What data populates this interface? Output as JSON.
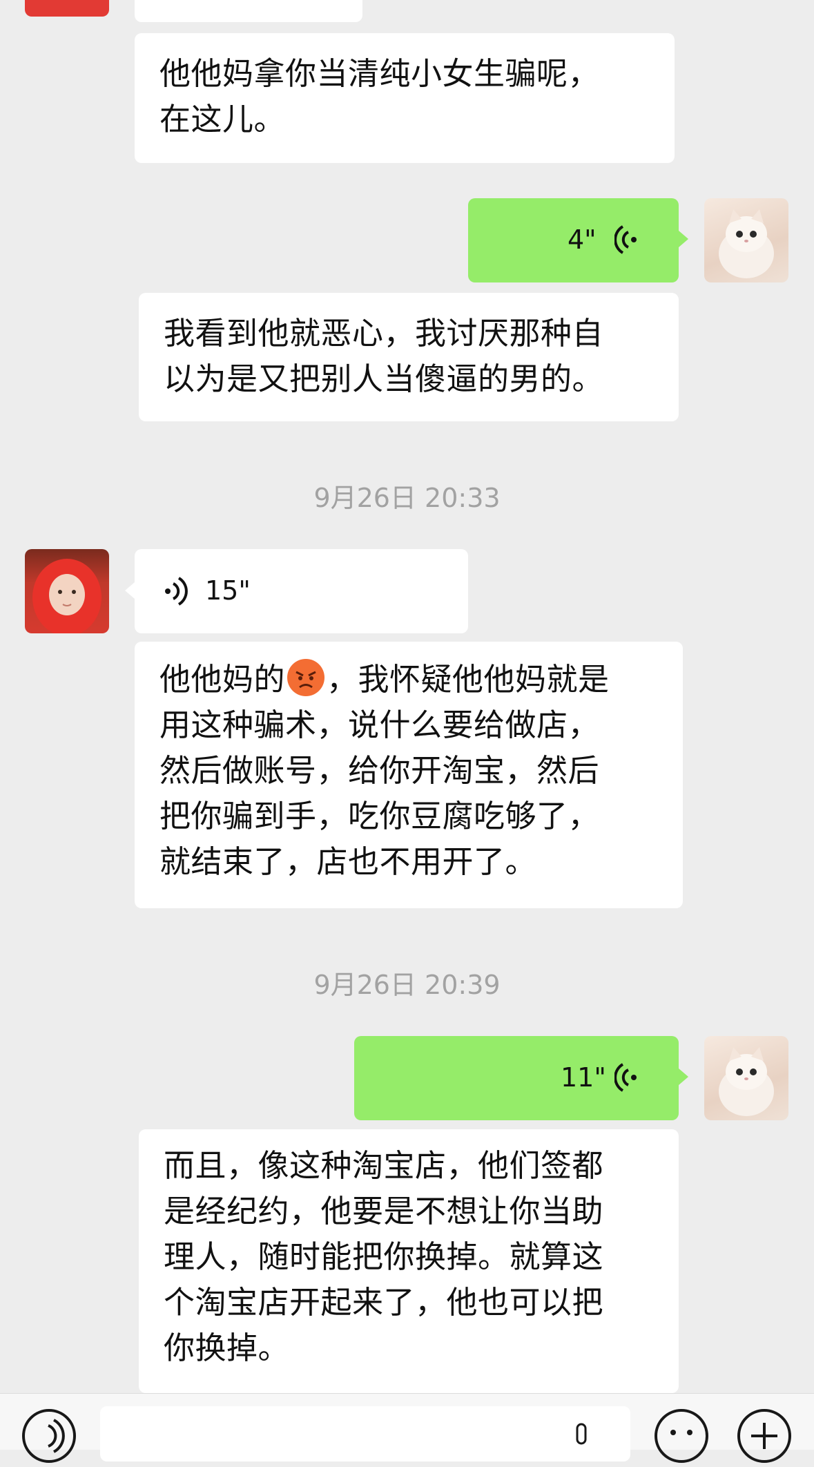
{
  "messages": [
    {
      "text": "他他妈拿你当清纯小女生骗呢，\n在这儿。"
    },
    {
      "duration": "4\""
    },
    {
      "text": "我看到他就恶心，我讨厌那种自\n以为是又把别人当傻逼的男的。"
    },
    {
      "timestamp": "9月26日 20:33"
    },
    {
      "duration": "15\""
    },
    {
      "text_before_emoji": "他他妈的",
      "emoji": "angry-face",
      "text_after_emoji": "，我怀疑他他妈就是\n用这种骗术，说什么要给做店，\n然后做账号，给你开淘宝，然后\n把你骗到手，吃你豆腐吃够了，\n就结束了，店也不用开了。"
    },
    {
      "timestamp": "9月26日 20:39"
    },
    {
      "duration": "11\""
    },
    {
      "text": "而且，像这种淘宝店，他们签都\n是经纪约，他要是不想让你当助\n理人，随时能把你换掉。就算这\n个淘宝店开起来了，他也可以把\n你换掉。"
    }
  ],
  "colors": {
    "background": "#ededed",
    "sent_bubble": "#95ec69",
    "received_bubble": "#ffffff",
    "timestamp": "#a2a2a2"
  },
  "icons": {
    "voice_sent": "voice-wave-icon",
    "voice_received": "voice-wave-icon",
    "input_voice": "voice-toggle-icon",
    "emoji": "emoji-icon",
    "plus": "plus-icon",
    "mic": "mic-icon"
  }
}
